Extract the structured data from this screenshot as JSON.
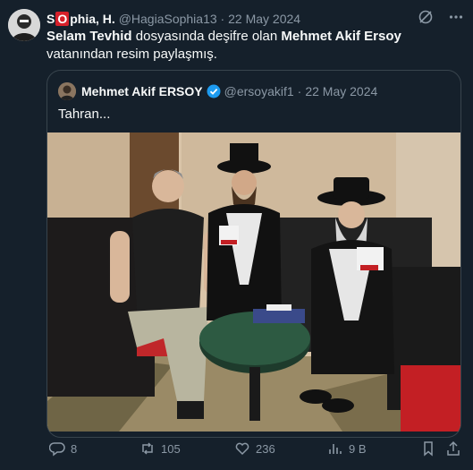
{
  "tweet": {
    "author_name_start": "S",
    "author_name_badge": "O",
    "author_name_end": "phia, H.",
    "handle": "@HagiaSophia13",
    "separator": "·",
    "date": "22 May 2024",
    "text_part1": "Selam Tevhid",
    "text_part2": " dosyasında deşifre olan ",
    "text_part3": "Mehmet Akif Ersoy",
    "text_part4": " vatanından resim paylaşmış."
  },
  "quote": {
    "author_name": "Mehmet Akif ERSOY",
    "handle": "@ersoyakif1",
    "separator": "·",
    "date": "22 May 2024",
    "text": "Tahran..."
  },
  "actions": {
    "replies": "8",
    "retweets": "105",
    "likes": "236",
    "views": "9 B"
  },
  "colors": {
    "background": "#15202b",
    "muted": "#8b98a5",
    "verified": "#1d9bf0",
    "badge_red": "#d6202a"
  }
}
